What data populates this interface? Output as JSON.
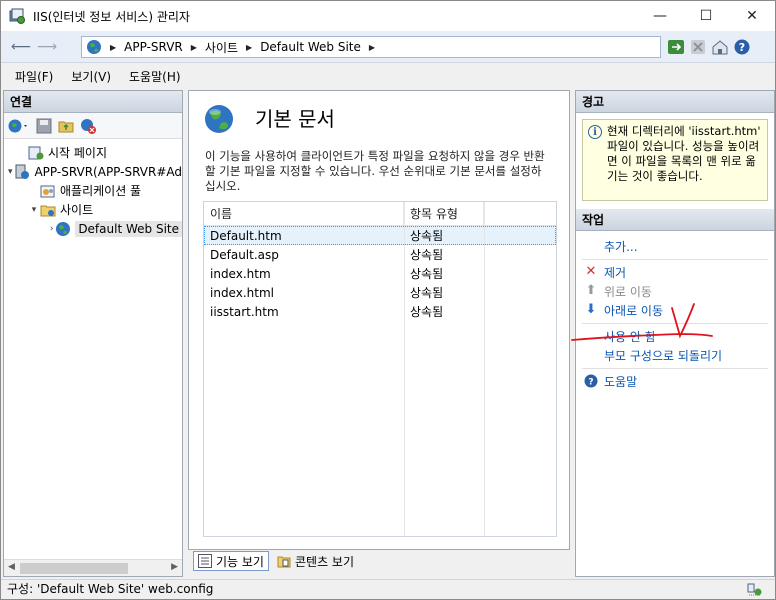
{
  "window": {
    "title": "IIS(인터넷 정보 서비스) 관리자"
  },
  "address": {
    "crumbs": [
      "APP-SRVR",
      "사이트",
      "Default Web Site"
    ]
  },
  "menu": {
    "items": [
      "파일(F)",
      "보기(V)",
      "도움말(H)"
    ]
  },
  "connections": {
    "header": "연결",
    "tree": [
      {
        "label": "시작 페이지",
        "level": 0,
        "expander": ""
      },
      {
        "label": "APP-SRVR(APP-SRVR#Ad",
        "level": 0,
        "expander": "▾"
      },
      {
        "label": "애플리케이션 풀",
        "level": 1,
        "expander": ""
      },
      {
        "label": "사이트",
        "level": 1,
        "expander": "▾"
      },
      {
        "label": "Default Web Site",
        "level": 2,
        "expander": "›"
      }
    ]
  },
  "feature": {
    "title": "기본 문서",
    "description": "이 기능을 사용하여 클라이언트가 특정 파일을 요청하지 않을 경우 반환할 기본 파일을 지정할 수 있습니다. 우선 순위대로 기본 문서를 설정하십시오.",
    "columns": [
      "이름",
      "항목 유형"
    ],
    "rows": [
      {
        "name": "Default.htm",
        "type": "상속됨"
      },
      {
        "name": "Default.asp",
        "type": "상속됨"
      },
      {
        "name": "index.htm",
        "type": "상속됨"
      },
      {
        "name": "index.html",
        "type": "상속됨"
      },
      {
        "name": "iisstart.htm",
        "type": "상속됨"
      }
    ]
  },
  "tabs": {
    "features": "기능 보기",
    "content": "콘텐츠 보기"
  },
  "alerts": {
    "header": "경고",
    "message": "현재 디렉터리에 'iisstart.htm' 파일이 있습니다. 성능을 높이려면 이 파일을 목록의 맨 위로 옮기는 것이 좋습니다."
  },
  "actions": {
    "header": "작업",
    "add": "추가...",
    "remove": "제거",
    "move_up": "위로 이동",
    "move_down": "아래로 이동",
    "disable": "사용 안 함",
    "revert": "부모 구성으로 되돌리기",
    "help": "도움말"
  },
  "status": {
    "text": "구성: 'Default Web Site' web.config"
  },
  "colors": {
    "link": "#0a56b3",
    "annotation": "#e0141e",
    "alert_bg": "#ffffe1"
  }
}
